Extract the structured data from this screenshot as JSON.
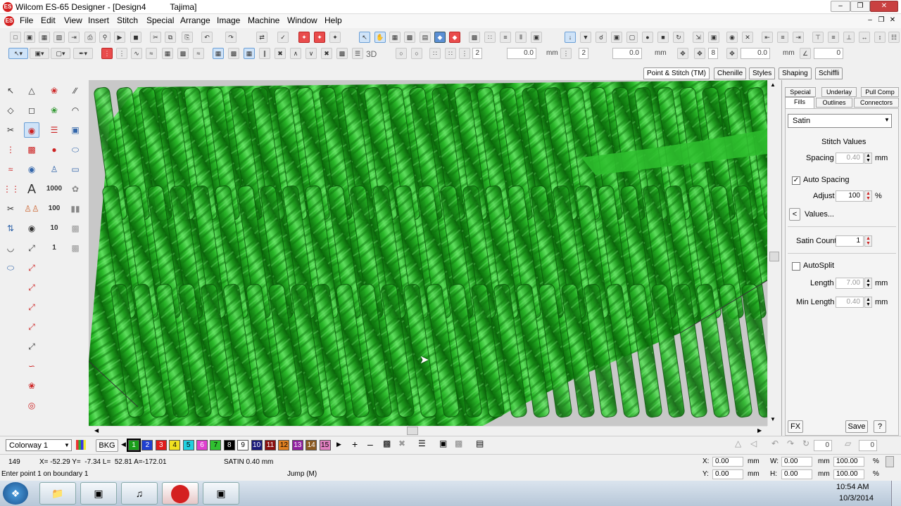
{
  "window": {
    "title": "Wilcom ES-65 Designer - [Design4",
    "title_extra": "Tajima]",
    "app_icon_text": "ES"
  },
  "menu": {
    "items": [
      "File",
      "Edit",
      "View",
      "Insert",
      "Stitch",
      "Special",
      "Arrange",
      "Image",
      "Machine",
      "Window",
      "Help"
    ]
  },
  "toolbar2": {
    "spacing_val_1": "2",
    "spacing_val_2": "0.0",
    "unit_mm": "mm",
    "count_val": "2",
    "angle_val": "0.0",
    "count_val_2": "8",
    "angle_val_2": "0.0",
    "rot_val": "0",
    "label_3d": "3D"
  },
  "tabs": [
    "Point & Stitch (TM)",
    "Chenille",
    "Styles",
    "Shaping",
    "Schiffli"
  ],
  "left_tool_numbers": [
    "1000",
    "100",
    "10",
    "1"
  ],
  "props": {
    "tabs_row1": [
      "Special",
      "Underlay",
      "Pull Comp"
    ],
    "tabs_row2": [
      "Fills",
      "Outlines",
      "Connectors"
    ],
    "fill_type": "Satin",
    "section_title": "Stitch Values",
    "spacing_label": "Spacing",
    "spacing_value": "0.40",
    "unit_mm": "mm",
    "auto_spacing_label": "Auto Spacing",
    "auto_spacing_checked": true,
    "adjust_label": "Adjust",
    "adjust_value": "100",
    "percent": "%",
    "values_button": "Values...",
    "satin_count_label": "Satin Count",
    "satin_count_value": "1",
    "autosplit_label": "AutoSplit",
    "autosplit_checked": false,
    "length_label": "Length",
    "length_value": "7.00",
    "min_length_label": "Min Length",
    "min_length_value": "0.40",
    "fx_button": "FX",
    "save_button": "Save",
    "help_button": "?"
  },
  "colorbar": {
    "colorway": "Colorway 1",
    "bkg": "BKG",
    "swatches": [
      {
        "n": "1",
        "c": "#1a9e1a",
        "t": "#fff"
      },
      {
        "n": "2",
        "c": "#1f3fd0",
        "t": "#fff"
      },
      {
        "n": "3",
        "c": "#e01c1c",
        "t": "#fff"
      },
      {
        "n": "4",
        "c": "#f0e020",
        "t": "#000"
      },
      {
        "n": "5",
        "c": "#20d0e0",
        "t": "#000"
      },
      {
        "n": "6",
        "c": "#e040d0",
        "t": "#fff"
      },
      {
        "n": "7",
        "c": "#30c030",
        "t": "#000"
      },
      {
        "n": "8",
        "c": "#000000",
        "t": "#fff"
      },
      {
        "n": "9",
        "c": "#ffffff",
        "t": "#000"
      },
      {
        "n": "10",
        "c": "#1a1a7a",
        "t": "#fff"
      },
      {
        "n": "11",
        "c": "#8a1010",
        "t": "#fff"
      },
      {
        "n": "12",
        "c": "#e08020",
        "t": "#000"
      },
      {
        "n": "13",
        "c": "#9020a0",
        "t": "#fff"
      },
      {
        "n": "14",
        "c": "#8a5a20",
        "t": "#fff"
      },
      {
        "n": "15",
        "c": "#e080c0",
        "t": "#000"
      }
    ],
    "right_val_1": "0",
    "right_val_2": "0"
  },
  "status": {
    "stitch_count": "149",
    "coords": "X= -52.29 Y=  -7.34 L=  52.81 A=-172.01",
    "stitch_type": "SATIN  0.40 mm",
    "prompt": "Enter point 1 on boundary 1",
    "jump": "Jump (M)",
    "x_label": "X:",
    "x_val": "0.00",
    "y_label": "Y:",
    "y_val": "0.00",
    "w_label": "W:",
    "w_val": "0.00",
    "h_label": "H:",
    "h_val": "0.00",
    "w_pct": "100.00",
    "h_pct": "100.00",
    "mm": "mm",
    "pct": "%"
  },
  "taskbar": {
    "time": "10:54 AM",
    "date": "10/3/2014"
  }
}
